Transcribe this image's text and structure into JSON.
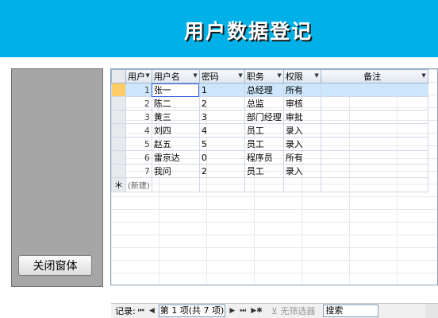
{
  "header": {
    "title": "用户数据登记"
  },
  "close_button": {
    "label": "关闭窗体"
  },
  "table": {
    "columns": [
      {
        "label": "用户"
      },
      {
        "label": "用户名"
      },
      {
        "label": "密码"
      },
      {
        "label": "职务"
      },
      {
        "label": "权限"
      },
      {
        "label": "备注"
      }
    ],
    "rows": [
      {
        "id": "1",
        "username": "张一",
        "password": "1",
        "position": "总经理",
        "permission": "所有",
        "note": ""
      },
      {
        "id": "2",
        "username": "陈二",
        "password": "2",
        "position": "总监",
        "permission": "审核",
        "note": ""
      },
      {
        "id": "3",
        "username": "黄三",
        "password": "3",
        "position": "部门经理",
        "permission": "审批",
        "note": ""
      },
      {
        "id": "4",
        "username": "刘四",
        "password": "4",
        "position": "员工",
        "permission": "录入",
        "note": ""
      },
      {
        "id": "5",
        "username": "赵五",
        "password": "5",
        "position": "员工",
        "permission": "录入",
        "note": ""
      },
      {
        "id": "6",
        "username": "雷京达",
        "password": "0",
        "position": "程序员",
        "permission": "所有",
        "note": ""
      },
      {
        "id": "7",
        "username": "我问",
        "password": "2",
        "position": "员工",
        "permission": "录入",
        "note": ""
      }
    ],
    "new_row_marker": "＊",
    "new_row_label": "(新建)"
  },
  "navigator": {
    "record_label": "记录:",
    "first_icon": "first-record-icon",
    "prev_icon": "previous-record-icon",
    "position_text": "第 1 项(共 7 项)",
    "next_icon": "next-record-icon",
    "last_icon": "last-record-icon",
    "new_icon": "new-record-icon",
    "filter_label": "无筛选器",
    "search_placeholder": "搜索"
  }
}
